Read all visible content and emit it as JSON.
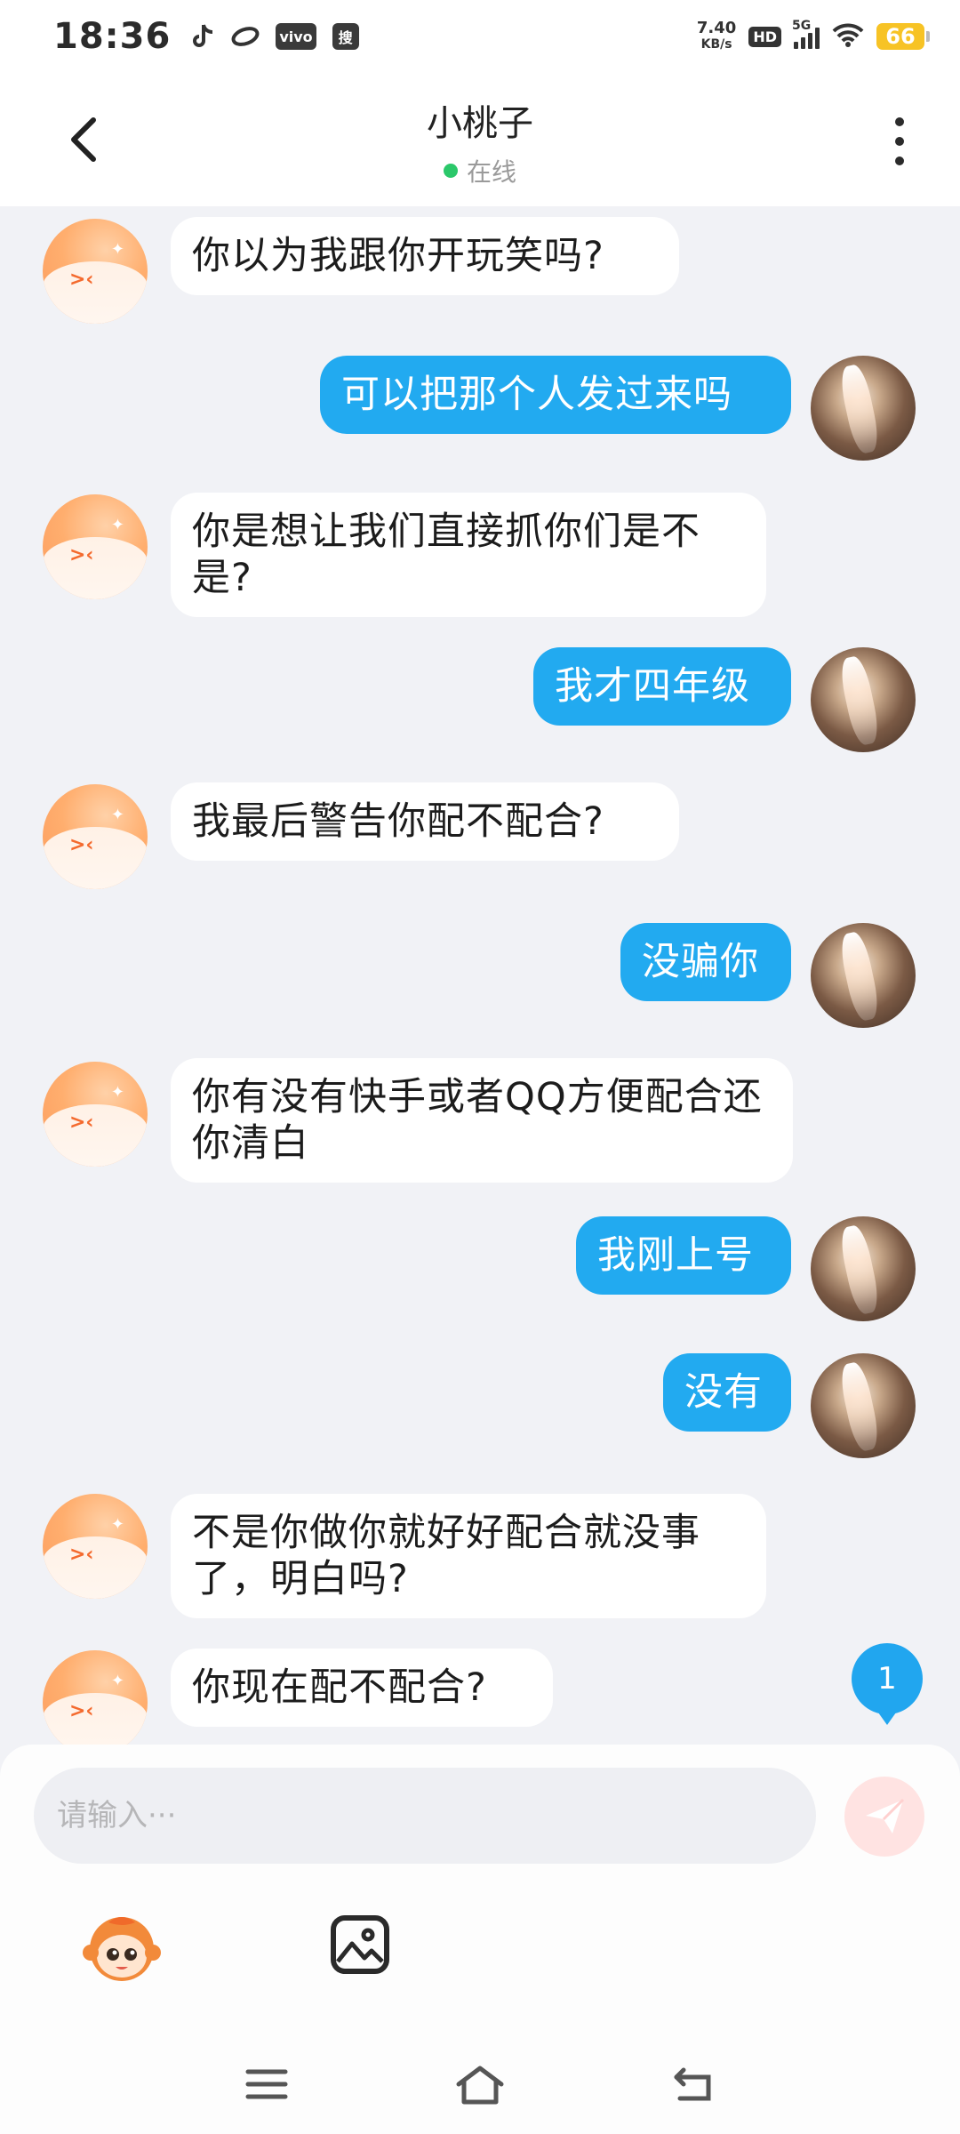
{
  "status_bar": {
    "time": "18:36",
    "net_speed_value": "7.40",
    "net_speed_unit": "KB/s",
    "hd_label": "HD",
    "signal_label": "5G",
    "battery_level": "66",
    "search_chip_label": "搜",
    "vivo_chip_label": "vivo",
    "icons": [
      "tiktok-icon",
      "link-icon",
      "vivo-icon",
      "sogou-icon",
      "hd-icon",
      "signal-icon",
      "wifi-icon",
      "battery-icon"
    ]
  },
  "header": {
    "title": "小桃子",
    "status": "在线",
    "back_icon": "chevron-left-icon",
    "more_icon": "more-vertical-icon"
  },
  "messages": [
    {
      "from": "bot",
      "text": "你以为我跟你开玩笑吗?"
    },
    {
      "from": "user",
      "text": "可以把那个人发过来吗"
    },
    {
      "from": "bot",
      "text": "你是想让我们直接抓你们是不是?"
    },
    {
      "from": "user",
      "text": "我才四年级"
    },
    {
      "from": "bot",
      "text": "我最后警告你配不配合?"
    },
    {
      "from": "user",
      "text": "没骗你"
    },
    {
      "from": "bot",
      "text": "你有没有快手或者QQ方便配合还你清白"
    },
    {
      "from": "user",
      "text": "我刚上号"
    },
    {
      "from": "user",
      "text": "没有"
    },
    {
      "from": "bot",
      "text": "不是你做你就好好配合就没事了，明白吗?"
    },
    {
      "from": "bot",
      "text": "你现在配不配合?"
    }
  ],
  "unread_badge": "1",
  "composer": {
    "placeholder": "请输入···",
    "value": "",
    "send_icon": "paper-plane-icon",
    "tools": [
      "mascot-icon",
      "image-icon"
    ]
  },
  "nav": {
    "icons": [
      "menu-icon",
      "home-icon",
      "back-icon"
    ]
  },
  "colors": {
    "outgoing_bubble": "#22aaf0",
    "incoming_bubble": "#ffffff",
    "background": "#f1f2f6",
    "online_dot": "#2bc86a",
    "battery": "#f7c325",
    "send_button": "#ffe3e2"
  }
}
